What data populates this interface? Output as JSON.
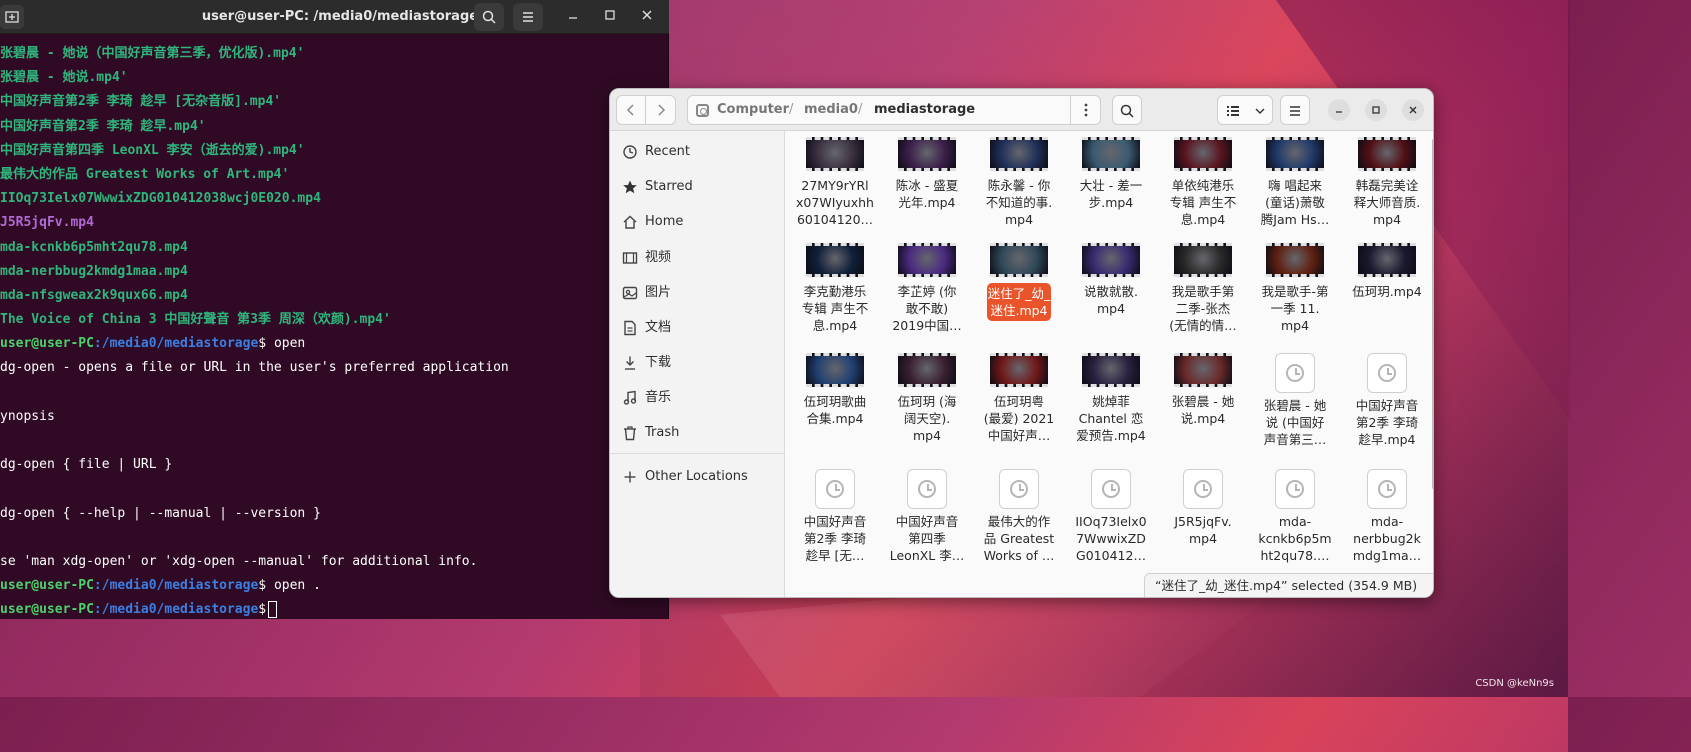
{
  "terminal": {
    "title": "user@user-PC: /media0/mediastorage",
    "lines": [
      "张碧晨 - 她说（中国好声音第三季，优化版).mp4'",
      "张碧晨 - 她说.mp4'",
      "中国好声音第2季 李琦 趁早 [无杂音版].mp4'",
      "中国好声音第2季 李琦 趁早.mp4'",
      "中国好声音第四季 LeonXL 李安（逝去的爱).mp4'",
      "最伟大的作品 Greatest Works of Art.mp4'",
      "IIOq73Ielx07WwwixZDG010412038wcj0E020.mp4",
      "J5R5jqFv.mp4",
      "mda-kcnkb6p5mht2qu78.mp4",
      "mda-nerbbug2kmdg1maa.mp4",
      "mda-nfsgweax2k9qux66.mp4",
      "The Voice of China 3 中国好聲音 第3季 周深（欢颜).mp4'"
    ],
    "prompt_user": "user@user-PC",
    "prompt_path": ":/media0/mediastorage",
    "prompt_sign": "$",
    "cmd1": " open",
    "out1": "dg-open - opens a file or URL in the user's preferred application",
    "out2": "ynopsis",
    "out3": "dg-open { file | URL }",
    "out4": "dg-open { --help | --manual | --version }",
    "out5": "se 'man xdg-open' or 'xdg-open --manual' for additional info.",
    "cmd2": " open ."
  },
  "files": {
    "path": {
      "crumb1": "Computer",
      "crumb2": "media0",
      "crumb3": "mediastorage",
      "sep": "/"
    },
    "sidebar": [
      {
        "label": "Recent",
        "icon": "clock-icon"
      },
      {
        "label": "Starred",
        "icon": "star-icon"
      },
      {
        "label": "Home",
        "icon": "home-icon"
      },
      {
        "label": "视频",
        "icon": "video-icon"
      },
      {
        "label": "图片",
        "icon": "image-icon"
      },
      {
        "label": "文档",
        "icon": "document-icon"
      },
      {
        "label": "下载",
        "icon": "download-icon"
      },
      {
        "label": "音乐",
        "icon": "music-icon"
      },
      {
        "label": "Trash",
        "icon": "trash-icon"
      }
    ],
    "other_locations": "Other Locations",
    "items": [
      {
        "l1": "27MY9rYRl",
        "l2": "x07WIyuxhh",
        "l3": "60104120…",
        "thumb": "#3a3040"
      },
      {
        "l1": "陈冰 - 盛夏",
        "l2": "光年.mp4",
        "l3": "",
        "thumb": "#3b1f4a"
      },
      {
        "l1": "陈永馨 - 你",
        "l2": "不知道的事.",
        "l3": "mp4",
        "thumb": "#20305a"
      },
      {
        "l1": "大壮 - 差一",
        "l2": "步.mp4",
        "l3": "",
        "thumb": "#3a5a70"
      },
      {
        "l1": "单依纯港乐",
        "l2": "专辑 声生不",
        "l3": "息.mp4",
        "thumb": "#5a1520"
      },
      {
        "l1": "嗨 唱起来",
        "l2": "(童话)萧敬",
        "l3": "腾Jam Hs…",
        "thumb": "#203a6a"
      },
      {
        "l1": "韩磊完美诠",
        "l2": "释大师音质.",
        "l3": "mp4",
        "thumb": "#501015"
      },
      {
        "l1": "李克勤港乐",
        "l2": "专辑 声生不",
        "l3": "息.mp4",
        "thumb": "#10203a"
      },
      {
        "l1": "李芷婷 (你",
        "l2": "敢不敢)",
        "l3": "2019中国…",
        "thumb": "#4a2a80"
      },
      {
        "l1": "迷住了_幼_",
        "l2": "迷住.mp4",
        "l3": "",
        "thumb": "#304858",
        "selected": true
      },
      {
        "l1": "说散就散.",
        "l2": "mp4",
        "l3": "",
        "thumb": "#3a2a70"
      },
      {
        "l1": "我是歌手第",
        "l2": "二季-张杰",
        "l3": "(无情的情…",
        "thumb": "#2a2a2a"
      },
      {
        "l1": "我是歌手-第",
        "l2": "一季 11.",
        "l3": "mp4",
        "thumb": "#602010"
      },
      {
        "l1": "伍珂玥.mp4",
        "l2": "",
        "l3": "",
        "thumb": "#1a1a30"
      },
      {
        "l1": "伍珂玥歌曲",
        "l2": "合集.mp4",
        "l3": "",
        "thumb": "#204070"
      },
      {
        "l1": "伍珂玥 (海",
        "l2": "阔天空).",
        "l3": "mp4",
        "thumb": "#3a2030"
      },
      {
        "l1": "伍珂玥粤",
        "l2": "(最爱) 2021",
        "l3": "中国好声…",
        "thumb": "#701818"
      },
      {
        "l1": "姚焯菲",
        "l2": "Chantel 恋",
        "l3": "爱预告.mp4",
        "thumb": "#2a2040"
      },
      {
        "l1": "张碧晨 - 她",
        "l2": "说.mp4",
        "l3": "",
        "thumb": "#6a2a2a"
      },
      {
        "l1": "张碧晨 - 她",
        "l2": "说 (中国好",
        "l3": "声音第三…",
        "placeholder": true
      },
      {
        "l1": "中国好声音",
        "l2": "第2季 李琦",
        "l3": "趁早.mp4",
        "placeholder": true
      },
      {
        "l1": "中国好声音",
        "l2": "第2季 李琦",
        "l3": "趁早 [无…",
        "placeholder": true
      },
      {
        "l1": "中国好声音",
        "l2": "第四季",
        "l3": "LeonXL 李…",
        "placeholder": true
      },
      {
        "l1": "最伟大的作",
        "l2": "品 Greatest",
        "l3": "Works of …",
        "placeholder": true
      },
      {
        "l1": "IIOq73Ielx0",
        "l2": "7WwwixZD",
        "l3": "G010412…",
        "placeholder": true
      },
      {
        "l1": "J5R5jqFv.",
        "l2": "mp4",
        "l3": "",
        "placeholder": true
      },
      {
        "l1": "mda-",
        "l2": "kcnkb6p5m",
        "l3": "ht2qu78.…",
        "placeholder": true
      },
      {
        "l1": "mda-",
        "l2": "nerbbug2k",
        "l3": "mdg1ma…",
        "placeholder": true
      }
    ],
    "status": "“迷住了_幼_迷住.mp4” selected  (354.9 MB)"
  },
  "watermark": "CSDN @keNn9s"
}
